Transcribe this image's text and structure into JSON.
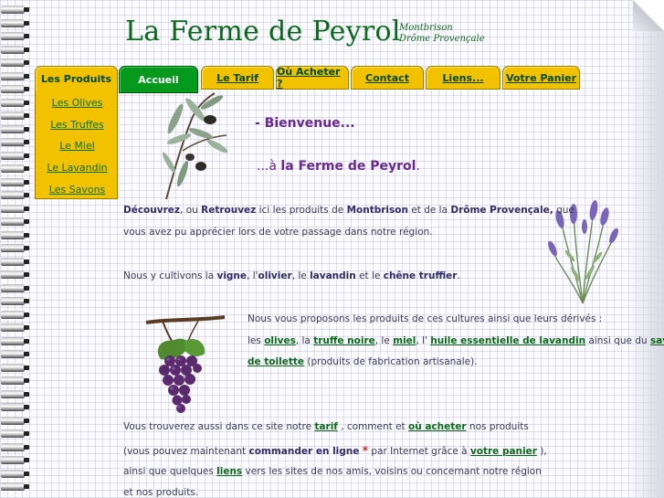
{
  "header": {
    "title": "La Ferme de Peyrol",
    "sub1": "Montbrison",
    "sub2": "Drôme Provençale"
  },
  "tabs": {
    "produits": "Les Produits",
    "accueil": "Accueil",
    "tarif": "Le Tarif",
    "acheter": "Où Acheter ?",
    "contact": "Contact",
    "liens": "Liens...",
    "panier": "Votre Panier"
  },
  "sidebar": [
    "Les Olives",
    "Les Truffes",
    "Le Miel",
    "Le Lavandin",
    "Les Savons"
  ],
  "welcome": {
    "line1": "- Bienvenue...",
    "line2_pre": "...à ",
    "line2_bold": "la Ferme de Peyrol",
    "line2_post": "."
  },
  "p1": {
    "w1": "Découvrez",
    "t1": ", ou ",
    "w2": "Retrouvez",
    "t2": " ici les produits de ",
    "w3": "Montbrison",
    "t3": " et de la ",
    "w4": "Drôme Provençale,",
    "t4": " que",
    "line2": "vous avez pu apprécier lors de votre passage dans notre région."
  },
  "p2": {
    "t1": "Nous y cultivons la ",
    "w1": "vigne",
    "t2": ", l'",
    "w2": "olivier",
    "t3": ", le ",
    "w3": "lavandin",
    "t4": " et le ",
    "w4": "chêne truffier",
    "t5": "."
  },
  "p3": {
    "line1": "Nous vous proposons les produits de ces cultures ainsi que leurs dérivés :",
    "t1": "les ",
    "l1": "olives",
    "t2": ", la ",
    "l2": "truffe noire",
    "t3": ", le ",
    "l3": "miel",
    "t4": ", l' ",
    "l4": "huile essentielle de lavandin",
    "t5": " ainsi que du ",
    "l5a": "savon",
    "l5b": "de toilette",
    "t6": " (produits de fabrication artisanale)."
  },
  "p4": {
    "t1": "Vous trouverez aussi dans ce site notre ",
    "l1": "tarif",
    "t2": " , comment et ",
    "l2": "où acheter",
    "t3": " nos produits",
    "t4": "(vous pouvez maintenant ",
    "b1": "commander en ligne",
    "star": "*",
    "t5": " par Internet grâce à ",
    "l3": "votre panier",
    "t6": " ),",
    "t7": "ainsi que quelques ",
    "l4": "liens",
    "t8": " vers les sites de nos amis, voisins ou concernant notre région",
    "t9": "et nos produits."
  }
}
